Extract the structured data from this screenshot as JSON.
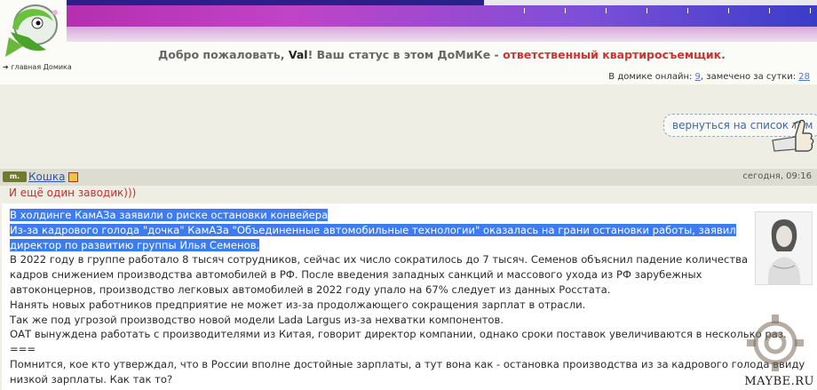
{
  "header": {
    "home_link": "➜ главная Домика",
    "welcome": {
      "prefix": "Добро пожаловать, ",
      "username": "Val",
      "middle": "! Ваш статус в этом ДоМиКе - ",
      "status": "ответственный квартиросъемщик",
      "suffix": "."
    },
    "online": {
      "label": "В домике онлайн: ",
      "online_count": "9",
      "sep": ", замечено за сутки: ",
      "day_count": "28"
    }
  },
  "nav": {
    "back_label": "вернуться на список тем"
  },
  "post": {
    "author_badge": "m.",
    "author": "Кошка",
    "date": "сегодня, 09:16",
    "subtitle": "И ещё один заводик)))",
    "lines": [
      "В холдинге КамАЗа заявили о риске остановки конвейера",
      "Из-за кадрового голода \"дочка\" КамАЗа \"Объединенные автомобильные технологии\" оказалась на грани остановки работы, заявил",
      "директор по развитию группы Илья Семенов.",
      "В 2022 году в группе работало 8 тысяч сотрудников, сейчас их число сократилось до 7 тысяч. Семенов объяснил падение количества",
      "кадров снижением производства автомобилей в РФ. После введения западных санкций и массового ухода из РФ зарубежных",
      "автоконцернов, производство легковых автомобилей в 2022 году упало на 67% следует из данных Росстата.",
      "Нанять новых работников предприятие не может из-за продолжающего сокращения зарплат в отрасли.",
      "Так же под угрозой производство новой модели Lada Largus из-за нехватки компонентов.",
      "ОАТ вынуждена работать с производителями из Китая, говорит директор компании, однако сроки поставок увеличиваются в несколько раз.",
      "===",
      "Помнится, кое кто утверждал, что в России вполне достойные зарплаты, а тут вона как - остановка производства из за кадрового голода ввиду",
      "низкой зарплаты. Как так то?"
    ]
  },
  "watermark": "MAYBE.RU"
}
